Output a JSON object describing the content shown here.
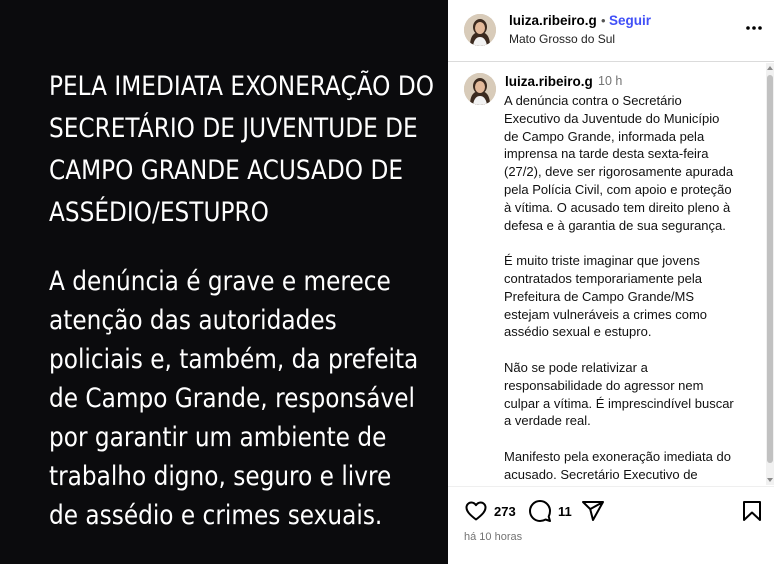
{
  "image_post": {
    "headline_lines": [
      "PELA IMEDIATA EXONERAÇÃO DO",
      "SECRETÁRIO DE JUVENTUDE DE",
      "CAMPO GRANDE ACUSADO DE",
      "ASSÉDIO/ESTUPRO"
    ],
    "body_lines": [
      "A denúncia é grave e merece",
      "atenção das autoridades",
      "policiais e, também, da prefeita",
      "de Campo Grande, responsável",
      "por garantir um ambiente de",
      "trabalho digno, seguro e livre",
      "de assédio e crimes sexuais."
    ]
  },
  "header": {
    "username": "luiza.ribeiro.g",
    "separator": "•",
    "follow_label": "Seguir",
    "location": "Mato Grosso do Sul",
    "more_icon": "more-horizontal-icon"
  },
  "caption": {
    "username": "luiza.ribeiro.g",
    "time": "10 h",
    "paragraphs": [
      [
        "A denúncia contra o Secretário",
        "Executivo da Juventude do Município",
        "de Campo Grande, informada pela",
        "imprensa na tarde desta sexta-feira",
        "(27/2), deve ser rigorosamente apurada",
        "pela Polícia Civil, com apoio e proteção",
        "à vítima. O acusado tem direito pleno à",
        "defesa e à garantia de sua segurança."
      ],
      [
        "É muito triste imaginar que jovens",
        "contratados temporariamente pela",
        "Prefeitura de Campo Grande/MS",
        "estejam vulneráveis a crimes como",
        "assédio sexual e estupro."
      ],
      [
        "Não se pode relativizar a",
        "responsabilidade do agressor nem",
        "culpar a vítima. É imprescindível buscar",
        "a verdade real."
      ],
      [
        "Manifesto pela exoneração imediata do",
        "acusado. Secretário Executivo de"
      ]
    ]
  },
  "actions": {
    "likes": "273",
    "comments": "11",
    "icons": [
      "heart-icon",
      "comment-icon",
      "share-icon",
      "bookmark-icon"
    ]
  },
  "time_ago": "há 10 horas"
}
